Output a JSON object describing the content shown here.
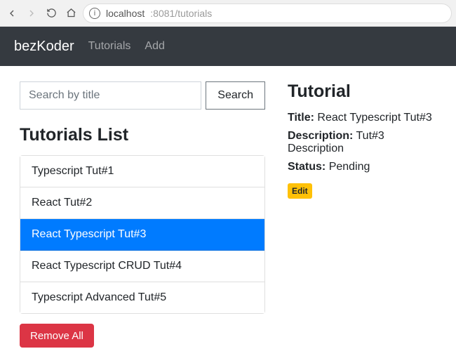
{
  "browser": {
    "url_host": "localhost",
    "url_port_path": ":8081/tutorials"
  },
  "navbar": {
    "brand": "bezKoder",
    "links": [
      {
        "label": "Tutorials"
      },
      {
        "label": "Add"
      }
    ]
  },
  "search": {
    "placeholder": "Search by title",
    "button": "Search"
  },
  "list": {
    "heading": "Tutorials List",
    "items": [
      {
        "title": "Typescript Tut#1",
        "active": false
      },
      {
        "title": "React Tut#2",
        "active": false
      },
      {
        "title": "React Typescript Tut#3",
        "active": true
      },
      {
        "title": "React Typescript CRUD Tut#4",
        "active": false
      },
      {
        "title": "Typescript Advanced Tut#5",
        "active": false
      }
    ],
    "remove_all": "Remove All"
  },
  "detail": {
    "heading": "Tutorial",
    "labels": {
      "title": "Title:",
      "description": "Description:",
      "status": "Status:"
    },
    "title": "React Typescript Tut#3",
    "description": "Tut#3 Description",
    "status": "Pending",
    "edit": "Edit"
  }
}
